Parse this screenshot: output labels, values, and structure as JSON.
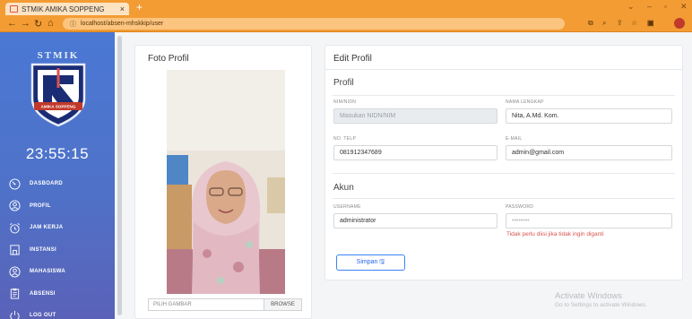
{
  "browser": {
    "tab_title": "STMIK AMIKA SOPPENG",
    "tab_close": "×",
    "new_tab": "+",
    "url": "localhost/absen-mhskkip/user",
    "colors": {
      "chrome": "#f39c34"
    }
  },
  "sidebar": {
    "logo_text": "STMIK",
    "logo_banner": "AMIKA SOPPENG",
    "clock": "23:55:15",
    "items": [
      {
        "label": "DASBOARD",
        "icon": "dashboard-icon"
      },
      {
        "label": "PROFIL",
        "icon": "profile-icon"
      },
      {
        "label": "JAM KERJA",
        "icon": "alarm-clock-icon"
      },
      {
        "label": "INSTANSI",
        "icon": "building-icon"
      },
      {
        "label": "MAHASISWA",
        "icon": "user-circle-icon"
      },
      {
        "label": "ABSENSI",
        "icon": "clipboard-icon"
      },
      {
        "label": "LOG OUT",
        "icon": "power-icon"
      }
    ]
  },
  "photo_card": {
    "title": "Foto Profil",
    "file_placeholder": "PILIH GAMBAR",
    "browse_label": "BROWSE"
  },
  "edit_card": {
    "title": "Edit Profil",
    "section_profil": "Profil",
    "section_akun": "Akun",
    "fields": {
      "nim_label": "NIM/NIDN",
      "nim_value": "Masukan NIDN/NIM",
      "nama_label": "NAMA LENGKAP",
      "nama_value": "Nita, A.Md. Kom.",
      "telp_label": "NO. TELP",
      "telp_value": "081912347689",
      "email_label": "E-MAIL",
      "email_value": "admin@gmail.com",
      "username_label": "USERNAME",
      "username_value": "administrator",
      "password_label": "PASSWORD",
      "password_value": "••••••••"
    },
    "password_hint": "Tidak perlu diisi jika tidak ingin diganti",
    "save_label": "Simpan 🖫"
  },
  "watermark": {
    "line1": "Activate Windows",
    "line2": "Go to Settings to activate Windows."
  }
}
